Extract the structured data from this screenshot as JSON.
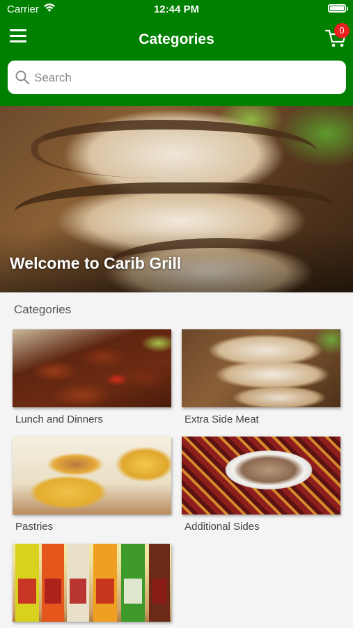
{
  "status_bar": {
    "carrier": "Carrier",
    "time": "12:44 PM"
  },
  "nav": {
    "title": "Categories",
    "cart_count": "0"
  },
  "search": {
    "placeholder": "Search"
  },
  "hero": {
    "welcome_text": "Welcome to Carib Grill"
  },
  "categories": {
    "section_title": "Categories",
    "items": [
      {
        "label": "Lunch and Dinners"
      },
      {
        "label": "Extra Side Meat"
      },
      {
        "label": "Pastries"
      },
      {
        "label": "Additional Sides"
      },
      {
        "label": ""
      }
    ]
  },
  "colors": {
    "header_green": "#008000",
    "badge_red": "#e8201f"
  },
  "icons": [
    "wifi-icon",
    "battery-icon",
    "menu-icon",
    "cart-icon",
    "search-icon"
  ]
}
